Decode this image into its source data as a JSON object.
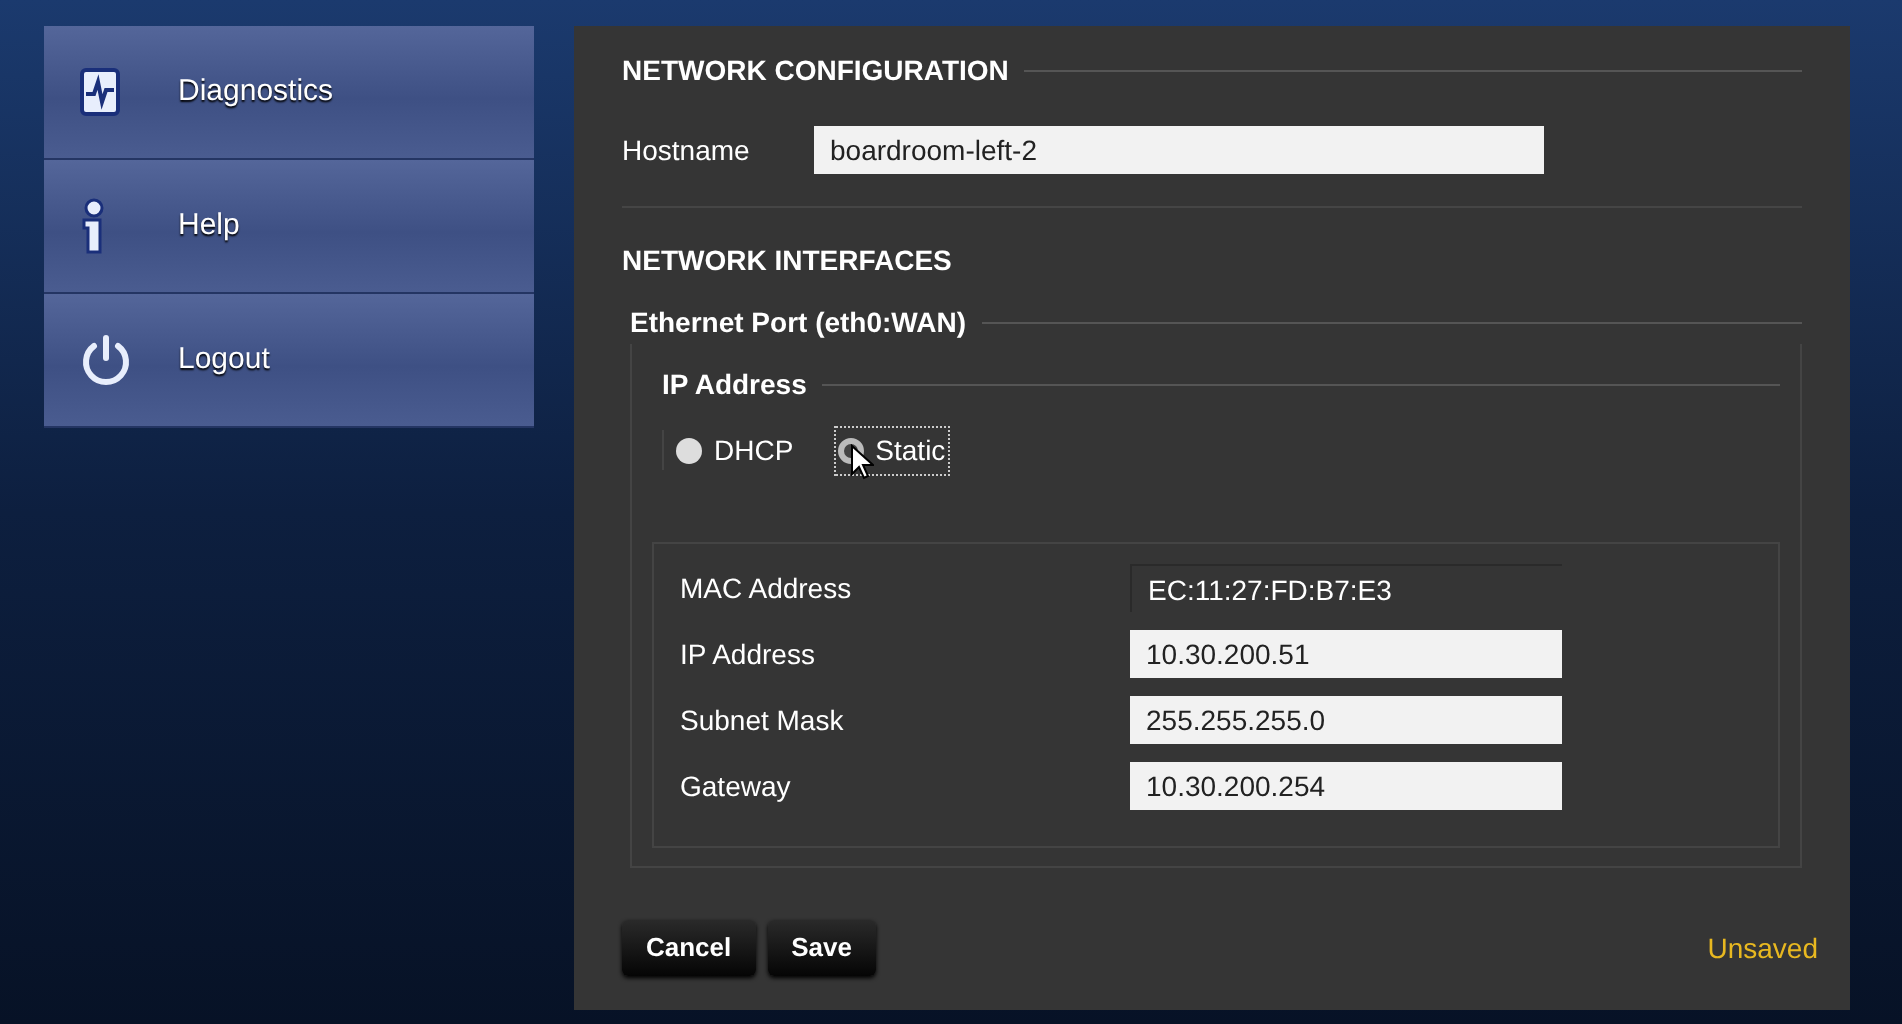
{
  "sidebar": {
    "items": [
      {
        "label": "Diagnostics",
        "kind": "diagnostics"
      },
      {
        "label": "Help",
        "kind": "info"
      },
      {
        "label": "Logout",
        "kind": "power"
      }
    ]
  },
  "network_configuration": {
    "title": "NETWORK CONFIGURATION",
    "hostname": {
      "label": "Hostname",
      "value": "boardroom-left-2"
    }
  },
  "network_interfaces": {
    "title": "NETWORK INTERFACES",
    "port": {
      "title": "Ethernet Port (eth0:WAN)",
      "ip_address": {
        "title": "IP Address",
        "options": [
          {
            "label": "DHCP",
            "selected": true
          },
          {
            "label": "Static",
            "selected": false,
            "focused": true
          }
        ]
      },
      "fields": [
        {
          "label": "MAC Address",
          "value": "EC:11:27:FD:B7:E3",
          "kind": "readonly"
        },
        {
          "label": "IP Address",
          "value": "10.30.200.51",
          "kind": "input"
        },
        {
          "label": "Subnet Mask",
          "value": "255.255.255.0",
          "kind": "input"
        },
        {
          "label": "Gateway",
          "value": "10.30.200.254",
          "kind": "input"
        }
      ]
    }
  },
  "buttons": [
    "Cancel",
    "Save"
  ],
  "status": "Unsaved"
}
